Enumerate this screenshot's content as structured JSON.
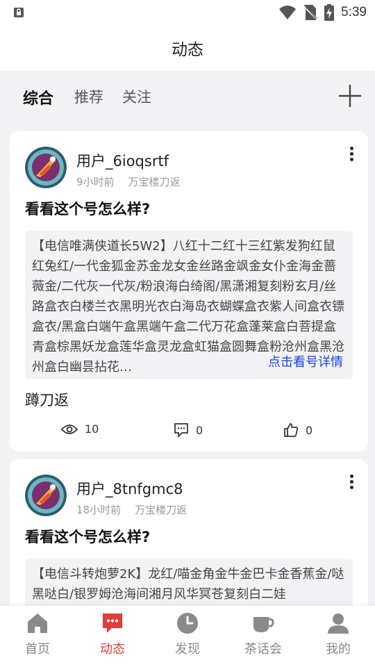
{
  "status_bar": {
    "time": "5:39"
  },
  "app_bar": {
    "title": "动态"
  },
  "tabs": [
    {
      "label": "综合",
      "active": true
    },
    {
      "label": "推荐",
      "active": false
    },
    {
      "label": "关注",
      "active": false
    }
  ],
  "posts": [
    {
      "username": "用户_6ioqsrtf",
      "time_ago": "9小时前",
      "location": "万宝楼刀返",
      "title": "看看这个号怎么样?",
      "description": "【电信唯满侠道长5W2】八红十二红十三红紫发狗红鼠红兔红/一代金狐金苏金龙女金丝路金飒金女仆金海金蔷薇金/二代灰一代灰/粉浪海白绮阁/黑潇湘复刻粉玄月/丝路盒衣白楼兰衣黑明光衣白海岛衣蝴蝶盒衣紫人间盒衣镖盒衣/黑盒白端午盒黑端午盒二代万花盒蓬莱盒白菩提盒青盒棕黑妖龙盒莲华盒灵龙盒虹猫盒圆舞盒粉沧州盒黑沧州盒白幽昙拈花…",
      "detail_link": "点击看号详情",
      "tag": "蹲刀返",
      "views": "10",
      "comments": "0",
      "likes": "0"
    },
    {
      "username": "用户_8tnfgmc8",
      "time_ago": "18小时前",
      "location": "万宝楼刀返",
      "title": "看看这个号怎么样?",
      "description": "【电信斗转炮萝2K】龙红/喵金角金牛金巴卡金香蕉金/哒黑哒白/银罗姆沧海间湘月风华冥苍复刻白二娃"
    }
  ],
  "bottom_nav": [
    {
      "label": "首页",
      "icon": "home-icon",
      "active": false
    },
    {
      "label": "动态",
      "icon": "chat-bubble-icon",
      "active": true
    },
    {
      "label": "发现",
      "icon": "clock-compass-icon",
      "active": false
    },
    {
      "label": "茶话会",
      "icon": "tea-cup-icon",
      "active": false
    },
    {
      "label": "我的",
      "icon": "person-icon",
      "active": false
    }
  ],
  "colors": {
    "accent": "#e23b3b",
    "link": "#1a3ee0",
    "background": "#f3f3f5"
  }
}
